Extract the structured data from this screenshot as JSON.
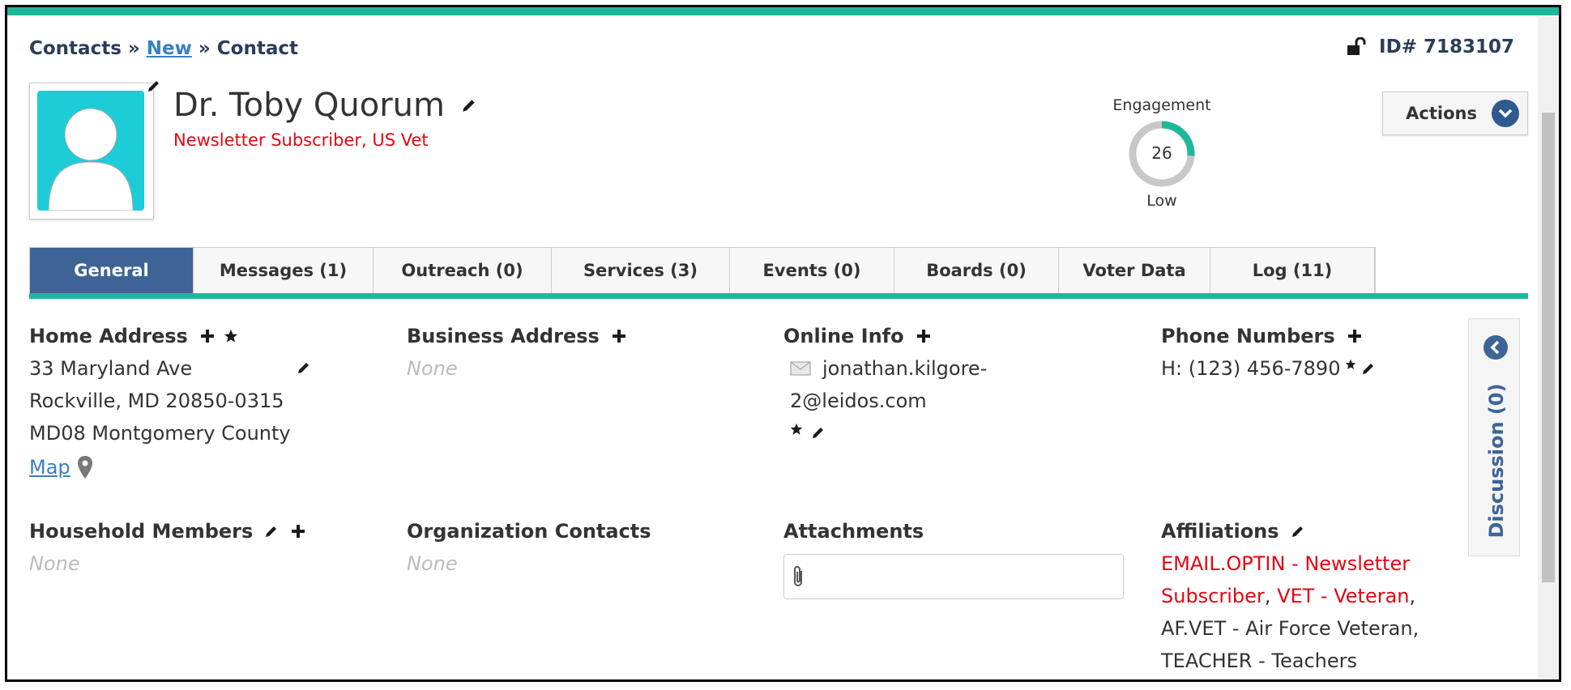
{
  "breadcrumb": {
    "root": "Contacts",
    "sep": "»",
    "mid": "New",
    "current": "Contact"
  },
  "record": {
    "id_label": "ID# 7183107"
  },
  "contact": {
    "name": "Dr. Toby Quorum",
    "tags": "Newsletter Subscriber, US Vet"
  },
  "engagement": {
    "label": "Engagement",
    "value": "26",
    "level": "Low",
    "fraction": 0.26
  },
  "actions": {
    "label": "Actions"
  },
  "tabs": [
    {
      "label": "General"
    },
    {
      "label": "Messages (1)"
    },
    {
      "label": "Outreach (0)"
    },
    {
      "label": "Services (3)"
    },
    {
      "label": "Events (0)"
    },
    {
      "label": "Boards (0)"
    },
    {
      "label": "Voter Data"
    },
    {
      "label": "Log (11)"
    }
  ],
  "home_address": {
    "title": "Home Address",
    "line1": "33 Maryland Ave",
    "line2": "Rockville, MD 20850-0315",
    "line3": "MD08 Montgomery County",
    "map_link": "Map"
  },
  "business_address": {
    "title": "Business Address",
    "value": "None"
  },
  "online_info": {
    "title": "Online Info",
    "email_line1": "jonathan.kilgore-",
    "email_line2": "2@leidos.com"
  },
  "phone_numbers": {
    "title": "Phone Numbers",
    "value": "H: (123) 456-7890"
  },
  "household": {
    "title": "Household Members",
    "value": "None"
  },
  "org_contacts": {
    "title": "Organization Contacts",
    "value": "None"
  },
  "attachments": {
    "title": "Attachments"
  },
  "affiliations": {
    "title": "Affiliations",
    "a1": "EMAIL.OPTIN - Newsletter",
    "a1b": "Subscriber",
    "a2": "VET - Veteran",
    "comma": ",",
    "a3": "AF.VET - Air Force Veteran,",
    "a4": "TEACHER - Teachers"
  },
  "discussion": {
    "label": "Discussion (0)"
  },
  "colors": {
    "accent": "#1fb79b",
    "tab_active": "#3e6496",
    "tag_red": "#e30613",
    "link": "#3a7fc1"
  }
}
